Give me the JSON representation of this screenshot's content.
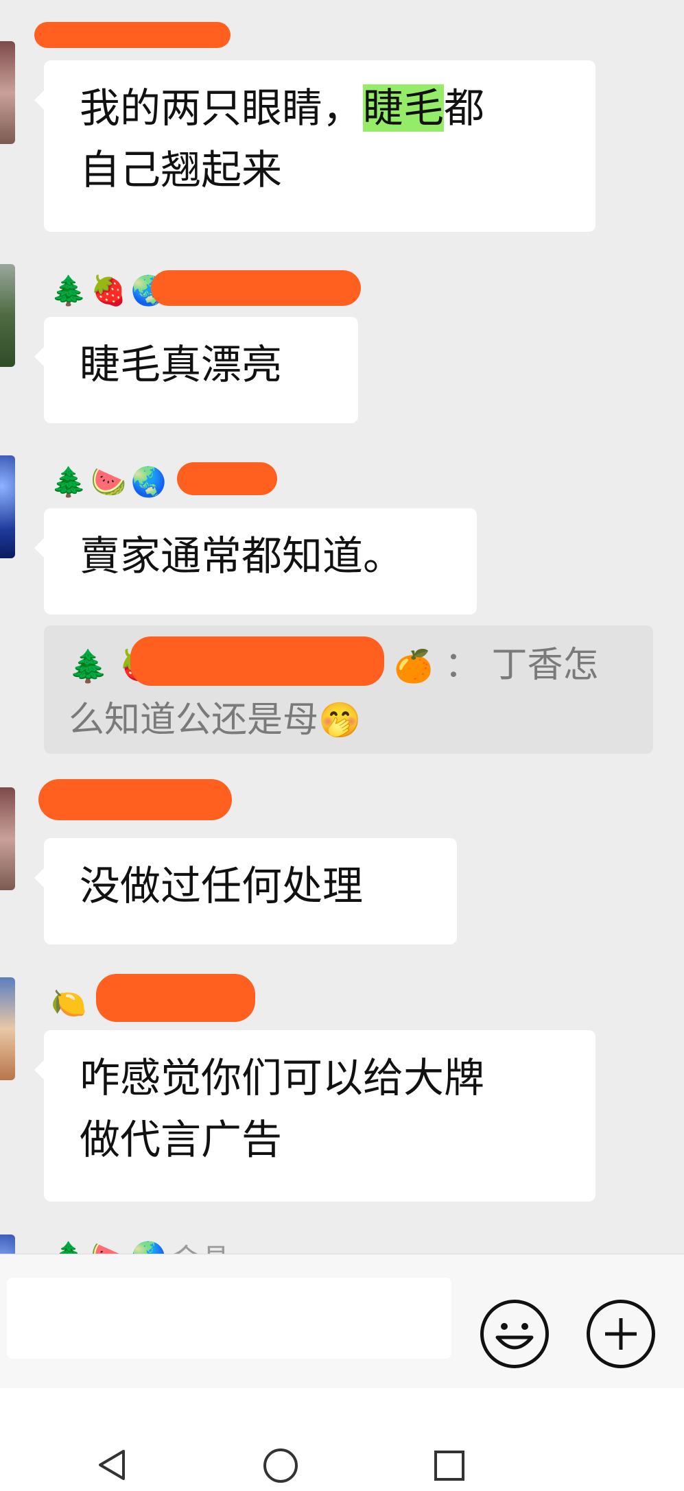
{
  "messages": [
    {
      "text": "我的两只眼睛，",
      "highlight": "睫毛",
      "tail": "都",
      "line2": "自己翘起来"
    },
    {
      "emojis": [
        "🌲",
        "🍓",
        "🌏"
      ],
      "text": "睫毛真漂亮"
    },
    {
      "emojis": [
        "🌲",
        "🍉",
        "🌏"
      ],
      "text": "賣家通常都知道。"
    },
    {
      "text": "没做过任何处理"
    },
    {
      "emojis": [
        "🍋"
      ],
      "text": "咋感觉你们可以给大牌",
      "line2": "做代言广告"
    },
    {
      "emojis": [
        "🌲",
        "🍉",
        "🌏"
      ],
      "partial_name": "金晶"
    }
  ],
  "quote": {
    "emojis": [
      "🌲",
      "🍓"
    ],
    "end_emoji": "🍊",
    "line1": "： 丁香怎",
    "line2": "么知道公还是母",
    "face_emoji": "🤭"
  },
  "input_bar": {
    "emoji_icon": "smiley-face-icon",
    "plus_icon": "plus-icon"
  },
  "nav": {
    "back_icon": "triangle-back-icon",
    "home_icon": "circle-home-icon",
    "recents_icon": "square-recents-icon"
  },
  "colors": {
    "background": "#ededed",
    "bubble": "#ffffff",
    "highlight": "#95ec69",
    "redaction": "#ff5f1f",
    "quote_bg": "#e2e2e2"
  }
}
